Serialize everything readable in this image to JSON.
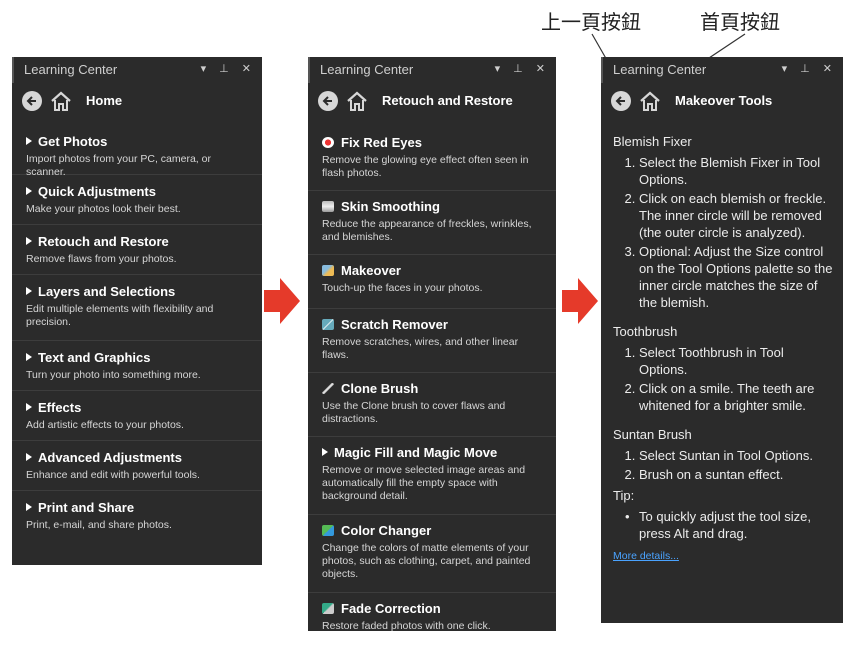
{
  "callouts": {
    "back_button": "上一頁按鈕",
    "home_button": "首頁按鈕"
  },
  "colors": {
    "panel_bg": "#2b2b2b",
    "arrow": "#e53a2a",
    "link": "#4aa3ff"
  },
  "panel1": {
    "title": "Learning Center",
    "controls": "▾ ⊥ ✕",
    "nav_title": "Home",
    "items": [
      {
        "title": "Get Photos",
        "desc": "Import photos from your PC, camera, or scanner."
      },
      {
        "title": "Quick Adjustments",
        "desc": "Make your photos look their best."
      },
      {
        "title": "Retouch and Restore",
        "desc": "Remove flaws from your photos."
      },
      {
        "title": "Layers and Selections",
        "desc": "Edit multiple elements with flexibility and precision."
      },
      {
        "title": "Text and Graphics",
        "desc": "Turn your photo into something more."
      },
      {
        "title": "Effects",
        "desc": "Add artistic effects to your photos."
      },
      {
        "title": "Advanced Adjustments",
        "desc": "Enhance and edit with powerful tools."
      },
      {
        "title": "Print and Share",
        "desc": "Print, e-mail, and share photos."
      }
    ]
  },
  "panel2": {
    "title": "Learning Center",
    "controls": "▾ ⊥ ✕",
    "nav_title": "Retouch and Restore",
    "items": [
      {
        "title": "Fix Red Eyes",
        "desc": "Remove the glowing eye effect often seen in flash photos.",
        "icon": "red-eye-icon"
      },
      {
        "title": "Skin Smoothing",
        "desc": "Reduce the appearance of freckles, wrinkles, and blemishes.",
        "icon": "skin-smoothing-icon"
      },
      {
        "title": "Makeover",
        "desc": "Touch-up the faces in your photos.",
        "icon": "makeover-icon"
      },
      {
        "title": "Scratch Remover",
        "desc": "Remove scratches, wires, and other linear flaws.",
        "icon": "scratch-remover-icon"
      },
      {
        "title": "Clone Brush",
        "desc": "Use the Clone brush to cover flaws and distractions.",
        "icon": "clone-brush-icon"
      },
      {
        "title": "Magic Fill and Magic Move",
        "desc": "Remove or move selected image areas and automatically fill the empty space with background detail.",
        "icon": "expand-triangle-icon"
      },
      {
        "title": "Color Changer",
        "desc": "Change the colors of matte elements of your photos, such as clothing, carpet, and painted objects.",
        "icon": "color-changer-icon"
      },
      {
        "title": "Fade Correction",
        "desc": "Restore faded photos with one click.",
        "icon": "fade-correction-icon"
      }
    ]
  },
  "panel3": {
    "title": "Learning Center",
    "controls": "▾ ⊥ ✕",
    "nav_title": "Makeover Tools",
    "blemish": {
      "heading": "Blemish Fixer",
      "steps": [
        "Select the Blemish Fixer in Tool Options.",
        "Click on each blemish or freckle. The inner circle will be removed (the outer circle is analyzed).",
        "Optional: Adjust the Size control on the Tool Options palette so the inner circle matches the size of the blemish."
      ]
    },
    "toothbrush": {
      "heading": "Toothbrush",
      "steps": [
        "Select Toothbrush in Tool Options.",
        "Click on a smile. The teeth are whitened for a brighter smile."
      ]
    },
    "suntan": {
      "heading": "Suntan Brush",
      "steps": [
        "Select Suntan in Tool Options.",
        "Brush on a suntan effect."
      ]
    },
    "tip": {
      "heading": "Tip:",
      "bullets": [
        "To quickly adjust the tool size, press Alt and drag."
      ]
    },
    "more_link": "More details..."
  }
}
